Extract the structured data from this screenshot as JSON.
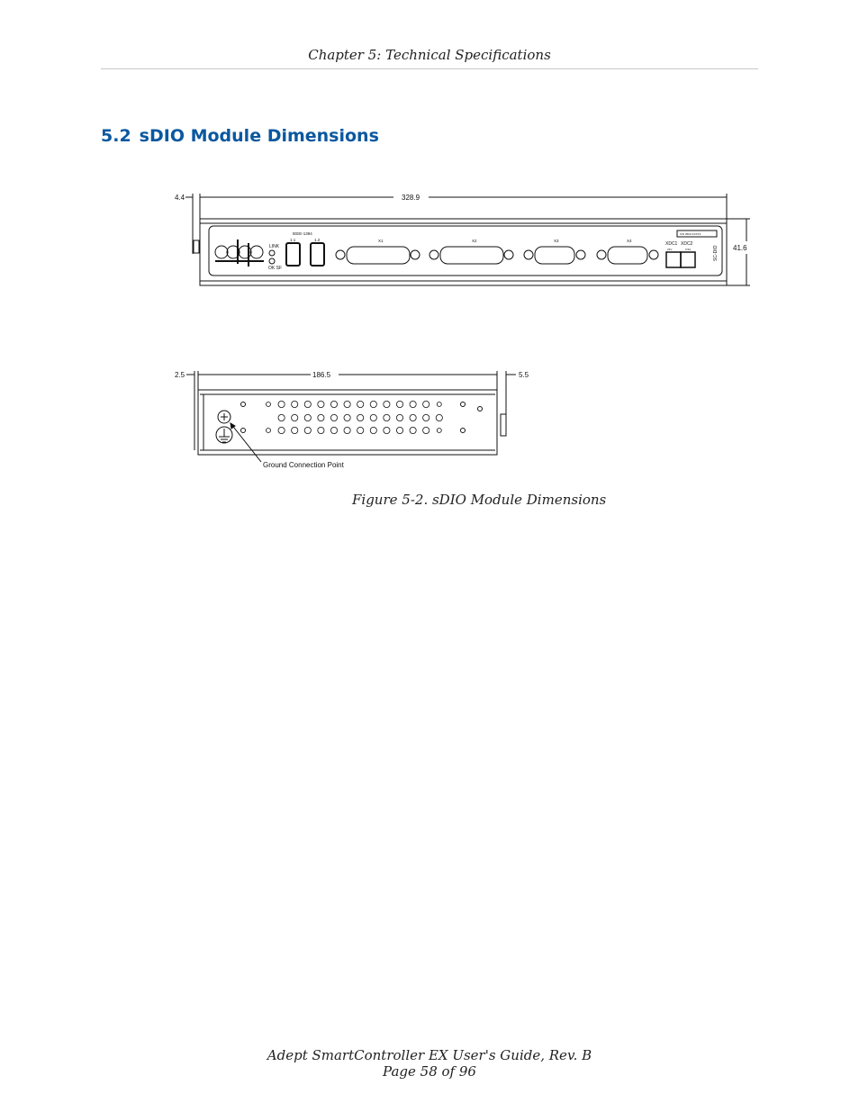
{
  "header": {
    "chapter": "Chapter 5: Technical Specifications"
  },
  "section": {
    "number": "5.2",
    "title": "sDIO Module Dimensions"
  },
  "figure": {
    "front_view": {
      "dim_width": "328.9",
      "dim_offset": "4.4",
      "dim_height": "41.6",
      "labels": {
        "ieee": "IEEE-1394",
        "port1": "1.1",
        "port2": "1.2",
        "link": "LINK",
        "ok_sf": "OK SF",
        "x1": "X1",
        "x2": "X2",
        "x3": "X3",
        "x4": "X4",
        "xdc1": "XDC1",
        "xdc2": "XDC2",
        "v24": "24V",
        "gnd": "0.5A",
        "serial": "S/N 3563-XXXXX",
        "sc_dio": "SC-DIO"
      }
    },
    "side_view": {
      "dim_width": "186.5",
      "dim_left": "2.5",
      "dim_right": "5.5",
      "ground_label": "Ground Connection Point"
    },
    "caption": "Figure 5-2. sDIO Module Dimensions"
  },
  "footer": {
    "line1": "Adept SmartController EX User's Guide, Rev. B",
    "line2": "Page 58 of 96"
  }
}
